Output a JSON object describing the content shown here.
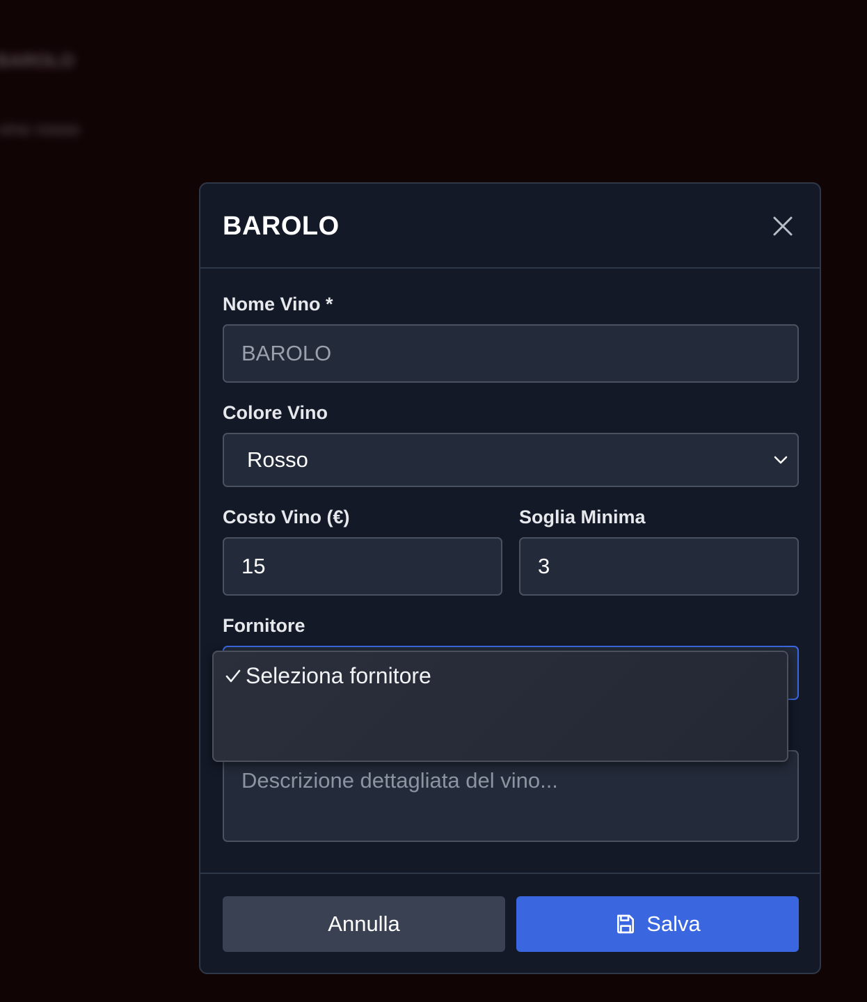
{
  "background": {
    "blurred_title": "BAROLO",
    "blurred_subtitle": "vino rosso"
  },
  "modal": {
    "title": "BAROLO",
    "close_icon": "close-icon",
    "fields": {
      "nome_vino": {
        "label": "Nome Vino *",
        "value": "BAROLO"
      },
      "colore_vino": {
        "label": "Colore Vino",
        "value": "Rosso"
      },
      "costo_vino": {
        "label": "Costo Vino (€)",
        "value": "15"
      },
      "soglia_minima": {
        "label": "Soglia Minima",
        "value": "3"
      },
      "fornitore": {
        "label": "Fornitore",
        "options": [
          {
            "label": "Seleziona fornitore",
            "selected": true
          }
        ]
      },
      "descrizione": {
        "placeholder": "Descrizione dettagliata del vino..."
      }
    },
    "footer": {
      "cancel_label": "Annulla",
      "save_label": "Salva",
      "save_icon": "floppy-disk-icon"
    }
  },
  "colors": {
    "accent": "#3a66e0",
    "modal_bg": "#131927",
    "field_bg": "#232a39",
    "page_bg": "#110405"
  }
}
